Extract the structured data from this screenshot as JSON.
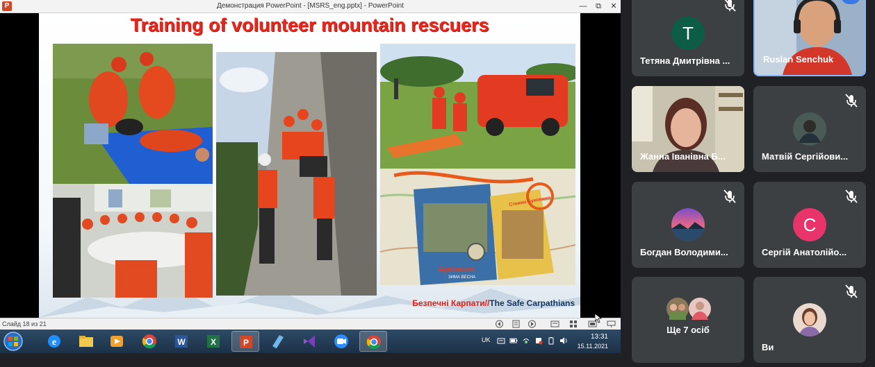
{
  "powerpoint": {
    "window_title": "Демонстрация PowerPoint - [MSRS_eng.pptx] - PowerPoint",
    "app_icon": "P",
    "minimize": "—",
    "restore": "⧉",
    "close": "✕",
    "slide_counter": "Слайд 18 из 21"
  },
  "slide": {
    "title": "Training of volunteer mountain rescuers",
    "caption_ua": "Безпечні Карпати//",
    "caption_en": "The Safe Carpathians",
    "map_brand": "Буковина",
    "map_brand_sub": "ЗИМА ВЕСНА",
    "map_title": "Стежки Буковини"
  },
  "taskbar": {
    "keyboard_lang": "UK",
    "time": "13:31",
    "date": "15.11.2021"
  },
  "participants": [
    {
      "name": "Тетяна Дмитрівна ...",
      "initial": "T",
      "avatar_color": "#0d5c46",
      "muted": true
    },
    {
      "name": "Ruslan Senchuk",
      "muted": false,
      "more": "•••"
    },
    {
      "name": "Жанна Іванівна Б...",
      "muted": false
    },
    {
      "name": "Матвій Сергійови...",
      "muted": true
    },
    {
      "name": "Богдан Володими...",
      "muted": true
    },
    {
      "name": "Сергій Анатолійо...",
      "initial": "C",
      "avatar_color": "#e8336b",
      "muted": true
    },
    {
      "name": "Ще 7 осіб"
    },
    {
      "name": "Ви",
      "muted": true
    }
  ],
  "colors": {
    "accent_blue": "#3b78e7",
    "slide_title_red": "#e8261c",
    "tile_bg": "#3c4043",
    "meet_bg": "#202124"
  }
}
